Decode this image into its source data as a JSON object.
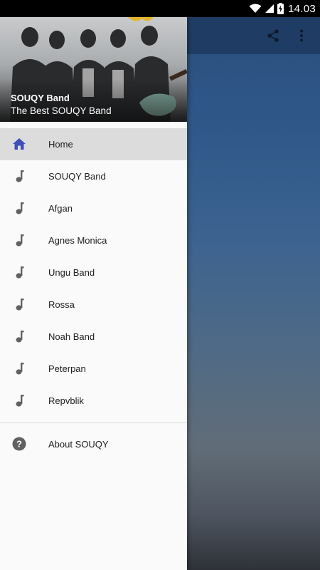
{
  "status_bar": {
    "time": "14.03",
    "icons": [
      "wifi-icon",
      "signal-icon",
      "battery-charging-icon"
    ]
  },
  "toolbar": {
    "actions": [
      "share-icon",
      "more-vert-icon"
    ]
  },
  "drawer": {
    "header": {
      "title": "SOUQY Band",
      "subtitle": "The Best SOUQY Band"
    },
    "items": [
      {
        "label": "Home",
        "icon": "home-icon",
        "active": true
      },
      {
        "label": "SOUQY Band",
        "icon": "music-note-icon"
      },
      {
        "label": "Afgan",
        "icon": "music-note-icon"
      },
      {
        "label": "Agnes Monica",
        "icon": "music-note-icon"
      },
      {
        "label": "Ungu Band",
        "icon": "music-note-icon"
      },
      {
        "label": "Rossa",
        "icon": "music-note-icon"
      },
      {
        "label": "Noah Band",
        "icon": "music-note-icon"
      },
      {
        "label": "Peterpan",
        "icon": "music-note-icon"
      },
      {
        "label": "Repvblik",
        "icon": "music-note-icon"
      }
    ],
    "footer_items": [
      {
        "label": "About SOUQY",
        "icon": "help-circle-icon"
      }
    ]
  },
  "colors": {
    "accent": "#3f51b5",
    "icon_gray": "#757575",
    "active_bg": "#dcdcdc"
  }
}
